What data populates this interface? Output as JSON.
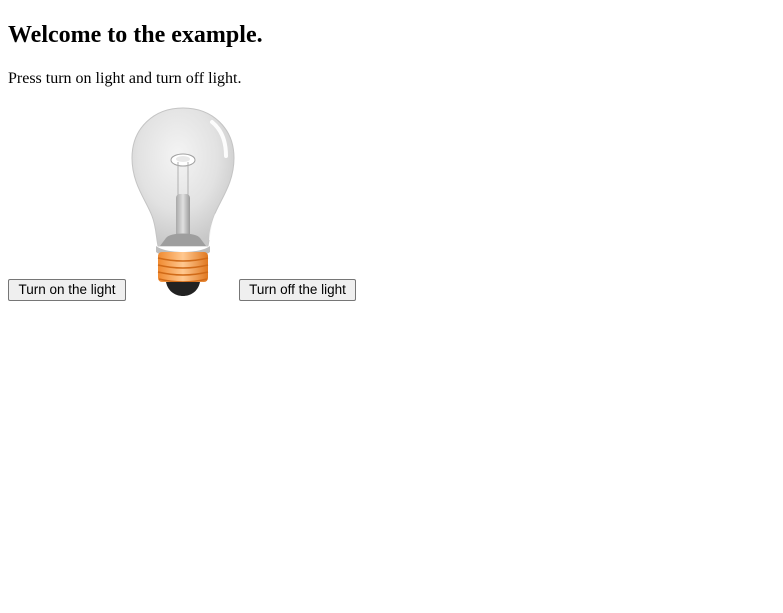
{
  "heading": "Welcome to the example.",
  "instructions": "Press turn on light and turn off light.",
  "buttons": {
    "turn_on_label": "Turn on the light",
    "turn_off_label": "Turn off the light"
  },
  "bulb": {
    "icon": "light-bulb-off-icon",
    "state": "off",
    "colors": {
      "glass": "#dcdcdc",
      "base": "#f5a55a",
      "tip": "#222222"
    }
  }
}
